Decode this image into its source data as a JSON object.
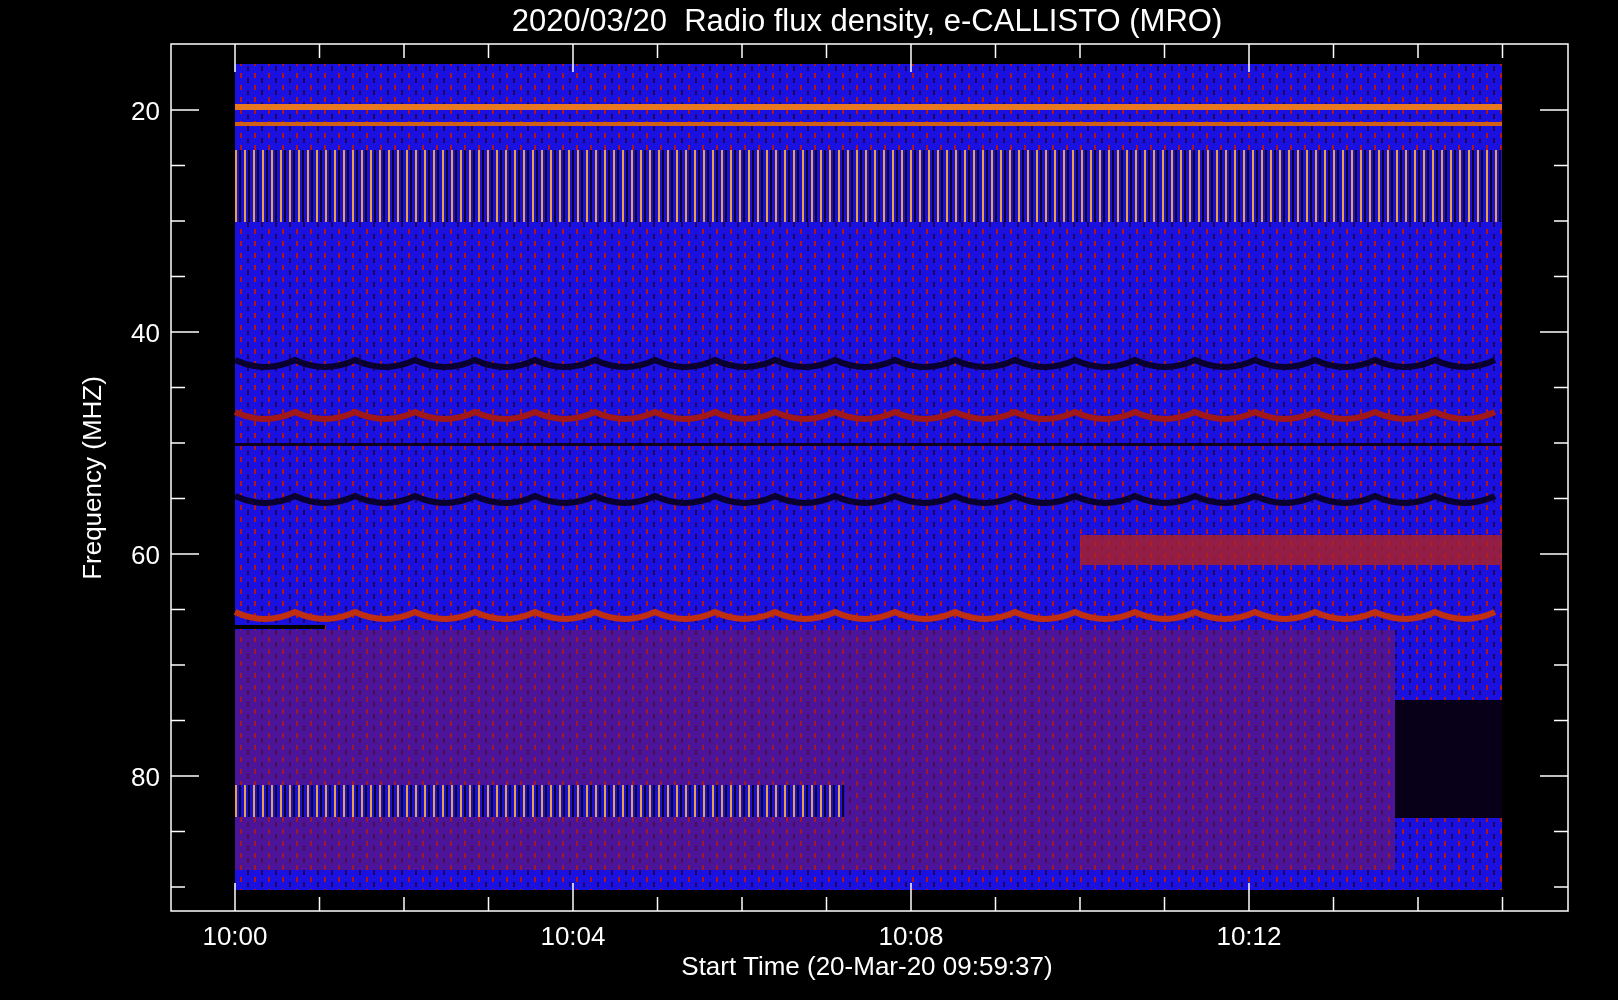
{
  "title": "2020/03/20  Radio flux density, e-CALLISTO (MRO)",
  "y_axis": {
    "label": "Frequency (MHZ)",
    "ticks": [
      "20",
      "40",
      "60",
      "80"
    ]
  },
  "x_axis": {
    "label": "Start Time (20-Mar-20 09:59:37)",
    "ticks": [
      "10:00",
      "10:04",
      "10:08",
      "10:12"
    ]
  }
}
